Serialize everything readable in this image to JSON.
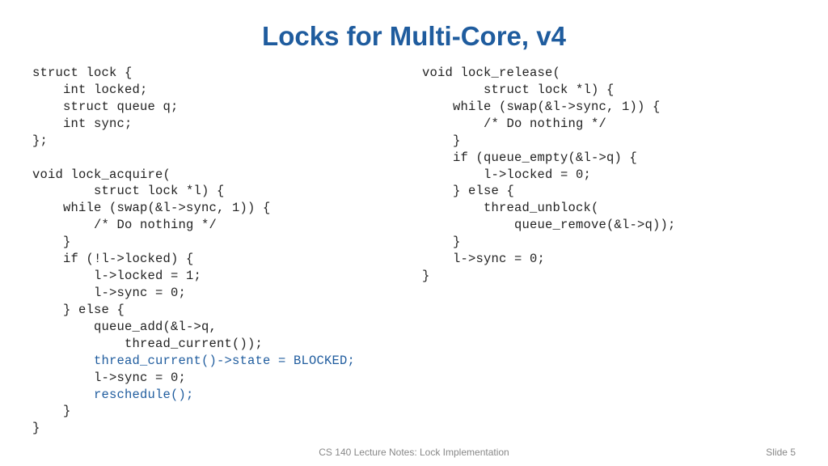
{
  "title": "Locks for Multi-Core, v4",
  "code_left_1": "struct lock {\n    int locked;\n    struct queue q;\n    int sync;\n};\n\nvoid lock_acquire(\n        struct lock *l) {\n    while (swap(&l->sync, 1)) {\n        /* Do nothing */\n    }\n    if (!l->locked) {\n        l->locked = 1;\n        l->sync = 0;\n    } else {\n        queue_add(&l->q,\n            thread_current());\n",
  "code_left_hl1": "        thread_current()->state = BLOCKED;\n",
  "code_left_2": "        l->sync = 0;\n",
  "code_left_hl2": "        reschedule();\n",
  "code_left_3": "    }\n}",
  "code_right": "void lock_release(\n        struct lock *l) {\n    while (swap(&l->sync, 1)) {\n        /* Do nothing */\n    }\n    if (queue_empty(&l->q) {\n        l->locked = 0;\n    } else {\n        thread_unblock(\n            queue_remove(&l->q));\n    }\n    l->sync = 0;\n}",
  "footer_center": "CS 140 Lecture Notes: Lock Implementation",
  "footer_right": "Slide 5"
}
